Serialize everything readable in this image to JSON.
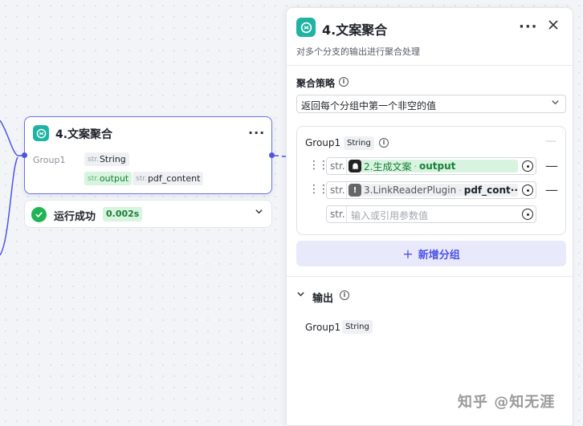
{
  "node": {
    "title": "4.文案聚合",
    "group_label": "Group1",
    "type_prefix": "str.",
    "type_name": "String",
    "inputs": [
      {
        "prefix": "str.",
        "name": "output",
        "style": "green"
      },
      {
        "prefix": "str.",
        "name": "pdf_content",
        "style": "gray"
      }
    ]
  },
  "run_status": {
    "text": "运行成功",
    "duration": "0.002s"
  },
  "panel": {
    "title": "4.文案聚合",
    "description": "对多个分支的输出进行聚合处理",
    "strategy_label": "聚合策略",
    "strategy_value": "返回每个分组中第一个非空的值",
    "group": {
      "name": "Group1",
      "type": "String",
      "refs": [
        {
          "prefix": "str.",
          "node": "2.生成文案",
          "var": "output",
          "style": "green"
        },
        {
          "prefix": "str.",
          "node": "3.LinkReaderPlugin",
          "var": "pdf_cont···",
          "style": "gray"
        }
      ],
      "empty_prefix": "str.",
      "empty_placeholder": "输入或引用参数值"
    },
    "add_group_label": "新增分组",
    "output_label": "输出",
    "output_name": "Group1",
    "output_type": "String"
  },
  "watermark": "知乎 @知无涯",
  "colors": {
    "accent": "#4d53e8",
    "node_icon": "#1fb3a4",
    "success": "#21b455",
    "green_tag_bg": "#d8f3df"
  },
  "icons": {
    "node": "aggregate-icon",
    "more": "more-dots-icon",
    "close": "close-icon",
    "info": "info-icon",
    "chevron": "chevron-down-icon",
    "drag": "drag-handle-icon",
    "ref": "variable-target-icon"
  }
}
